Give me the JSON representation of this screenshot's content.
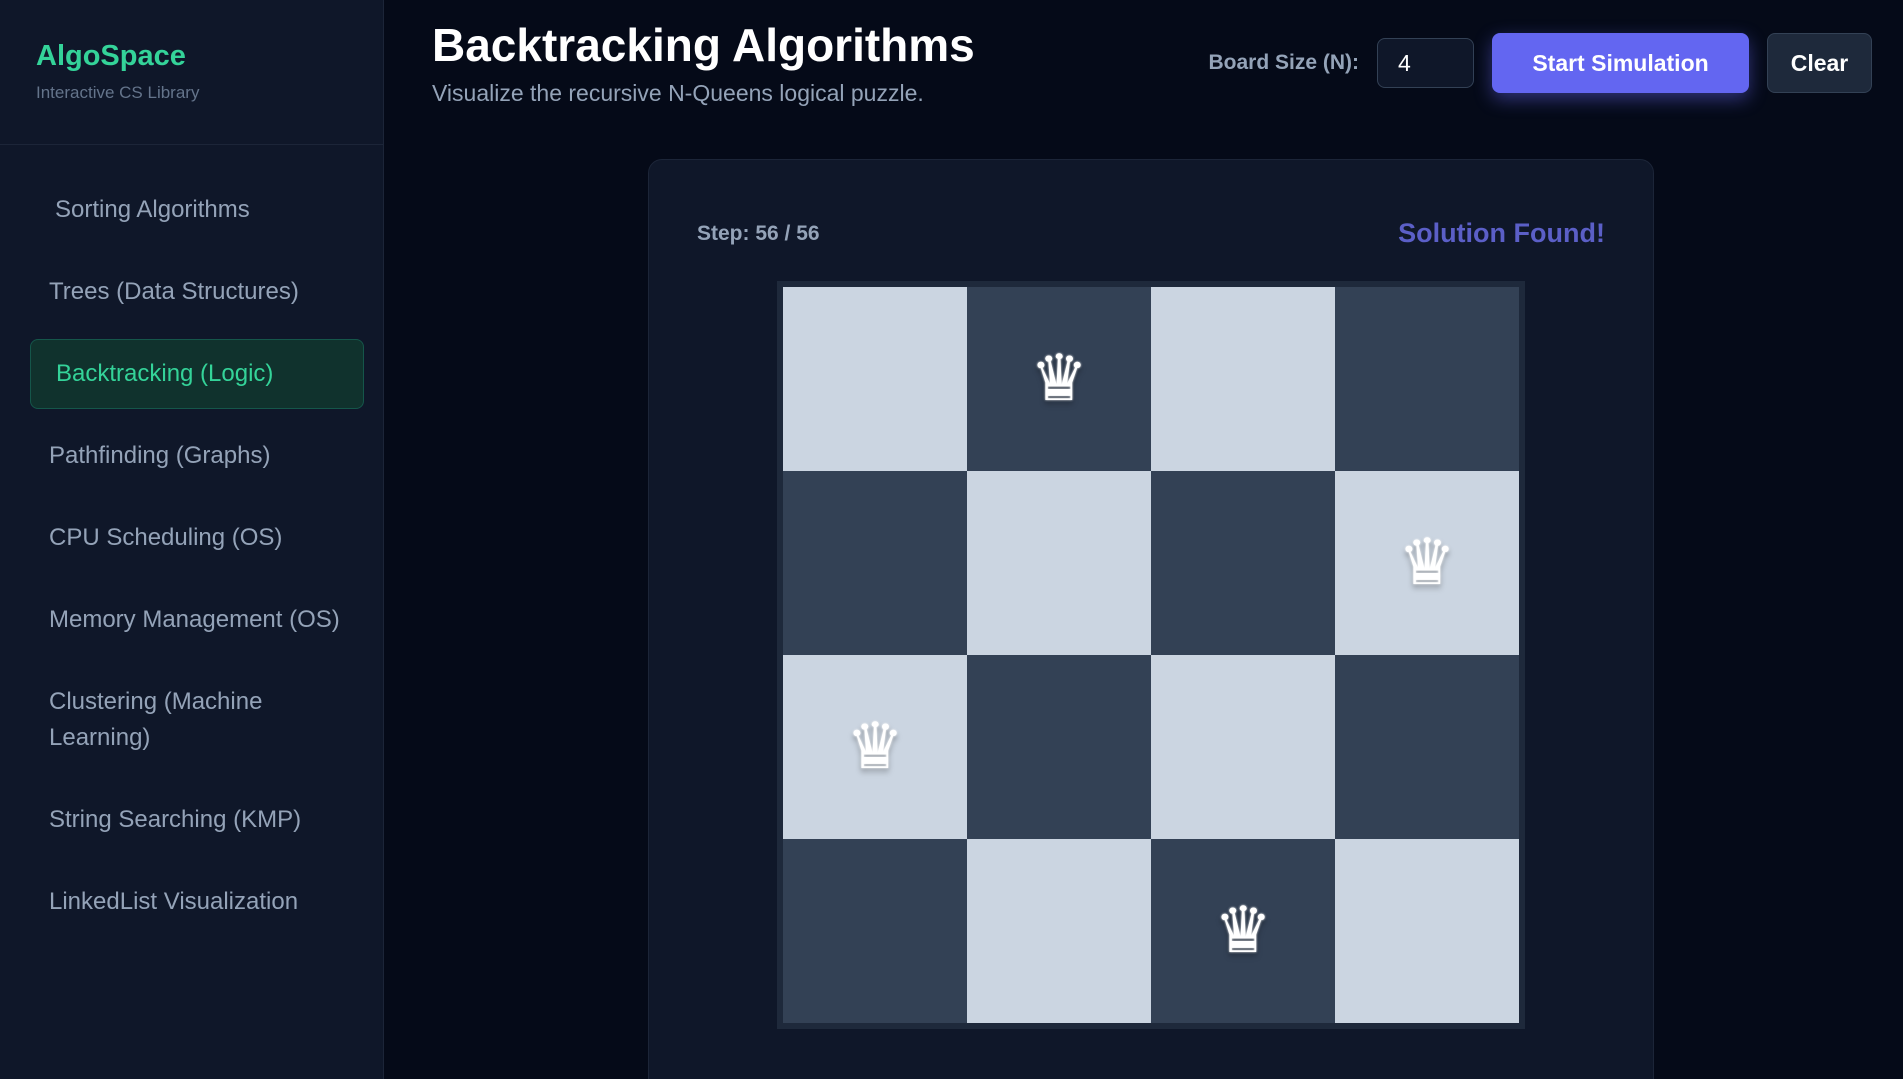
{
  "sidebar": {
    "brand": {
      "name": "AlgoSpace",
      "tagline": "Interactive CS Library"
    },
    "items": [
      {
        "label": "Sorting Algorithms"
      },
      {
        "label": "Trees (Data Structures)"
      },
      {
        "label": "Backtracking (Logic)",
        "active": true
      },
      {
        "label": "Pathfinding (Graphs)"
      },
      {
        "label": "CPU Scheduling (OS)"
      },
      {
        "label": "Memory Management (OS)"
      },
      {
        "label": "Clustering (Machine Learning)"
      },
      {
        "label": "String Searching (KMP)"
      },
      {
        "label": "LinkedList Visualization"
      }
    ]
  },
  "header": {
    "title": "Backtracking Algorithms",
    "subtitle": "Visualize the recursive N-Queens logical puzzle.",
    "board_size_label": "Board Size (N):",
    "board_size_value": "4",
    "start_label": "Start Simulation",
    "clear_label": "Clear"
  },
  "simulation": {
    "step_text": "Step: 56 / 56",
    "status_text": "Solution Found!",
    "board_size": 4,
    "queen_columns_by_row": [
      1,
      3,
      0,
      2
    ],
    "queen_glyph": "♛"
  },
  "colors": {
    "accent": "#6366f1",
    "brand": "#34d399",
    "status": "#5b5fc7",
    "light_square": "#cbd5e1",
    "dark_square": "#334155"
  }
}
